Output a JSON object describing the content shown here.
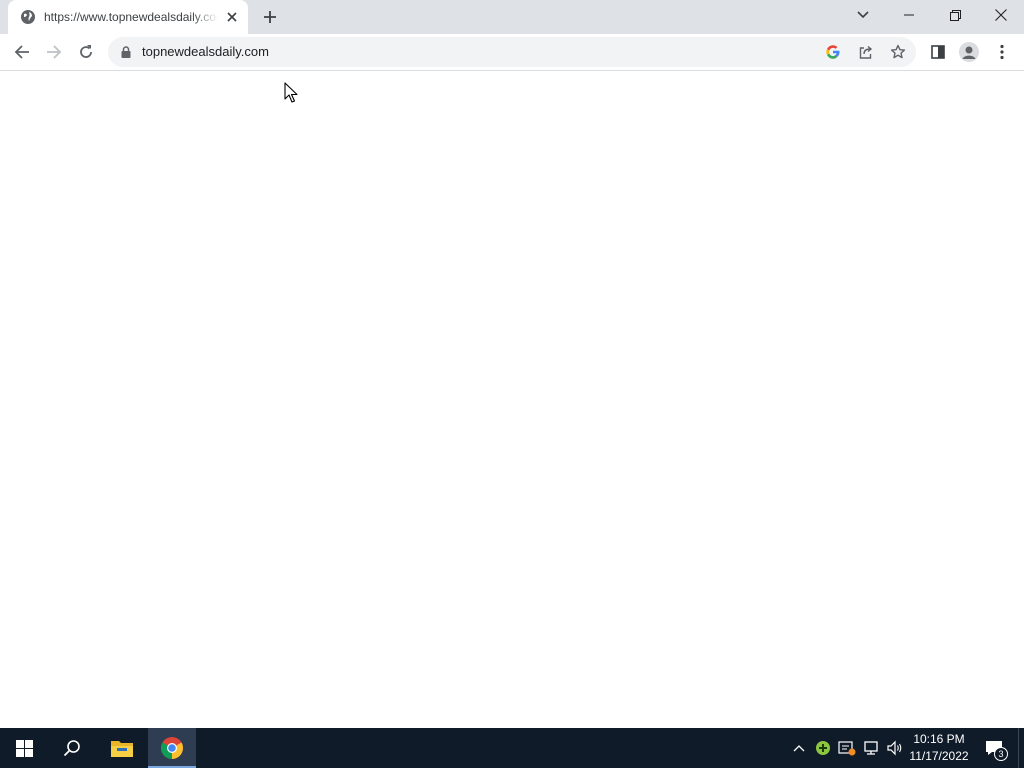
{
  "browser": {
    "tab": {
      "title": "https://www.topnewdealsdaily.com",
      "favicon": "globe-icon"
    },
    "toolbar": {
      "url": "topnewdealsdaily.com",
      "icons": [
        "back-arrow-icon",
        "forward-arrow-icon",
        "reload-icon",
        "lock-icon",
        "google-icon",
        "share-icon",
        "star-icon",
        "side-panel-icon",
        "profile-icon",
        "kebab-menu-icon"
      ]
    },
    "window_controls": [
      "tab-search-icon",
      "minimize-icon",
      "restore-icon",
      "close-icon"
    ]
  },
  "taskbar": {
    "apps": [
      "windows-start-icon",
      "search-icon",
      "file-explorer-icon",
      "chrome-icon"
    ],
    "tray_icons": [
      "chevron-up-icon",
      "plus-badge-icon",
      "alert-icon",
      "network-icon",
      "volume-icon"
    ],
    "clock": {
      "time": "10:16 PM",
      "date": "11/17/2022"
    },
    "notification_count": "3"
  },
  "colors": {
    "tabstrip_bg": "#dee1e6",
    "omnibox_bg": "#f1f3f4",
    "taskbar_bg": "#101b2a",
    "chrome_highlight": "#2e3d52"
  }
}
